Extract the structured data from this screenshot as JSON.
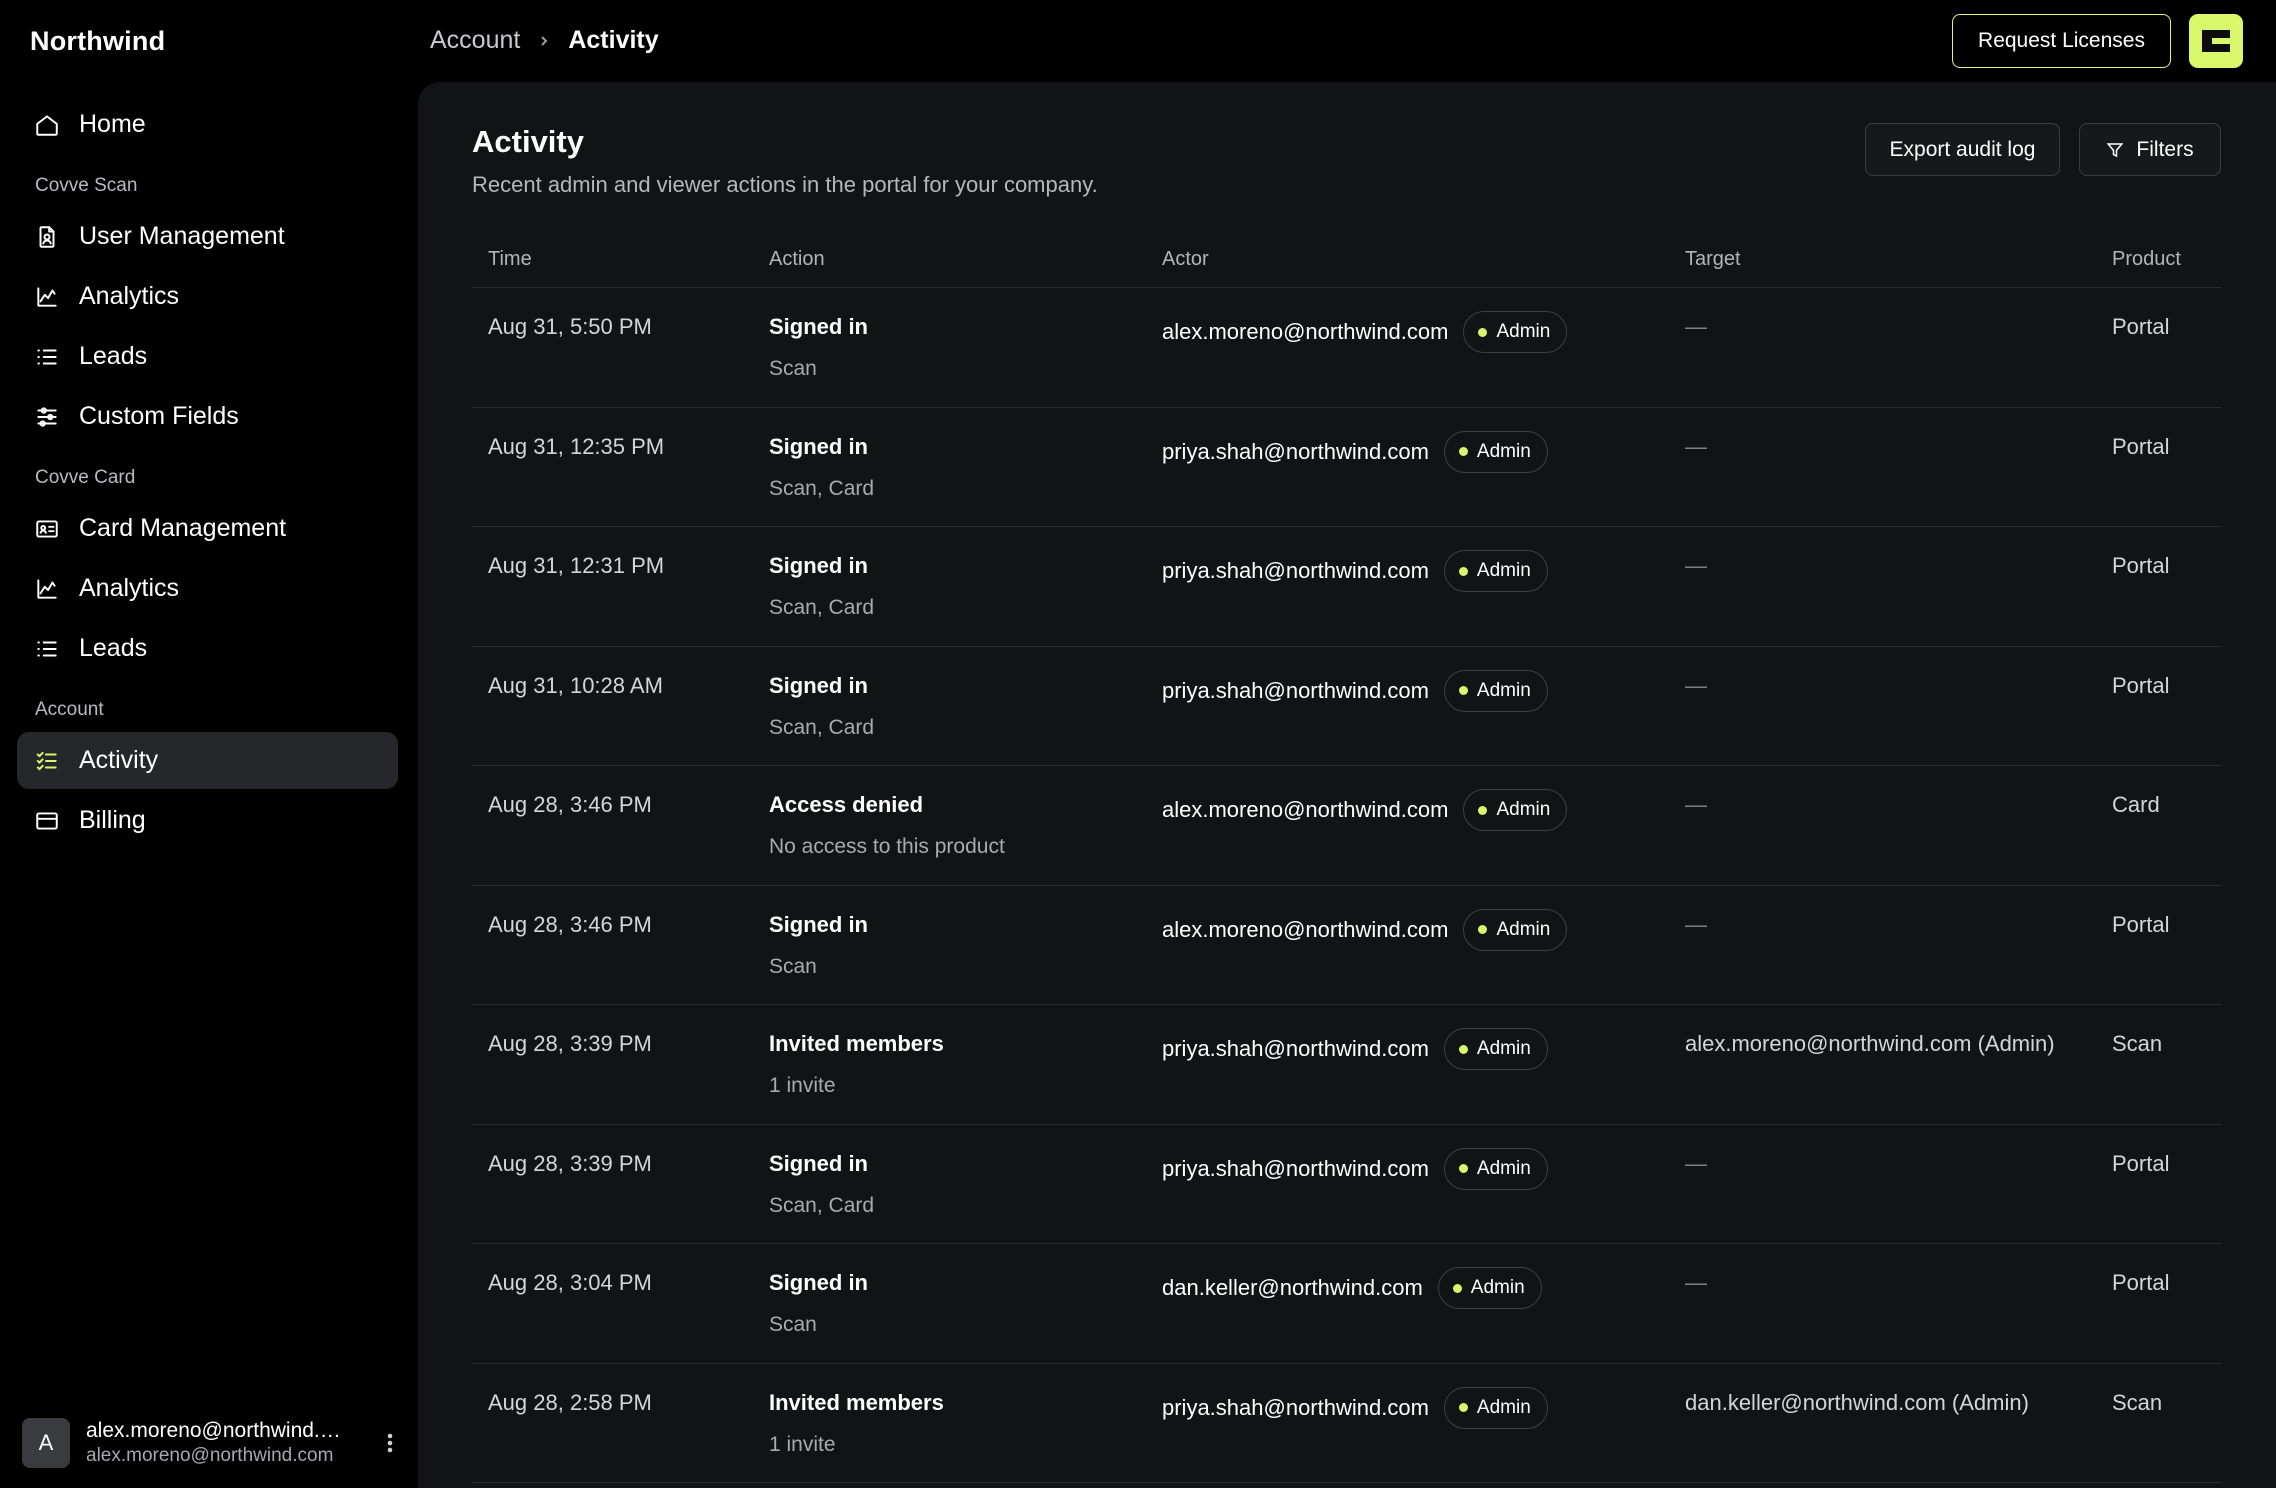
{
  "app": {
    "name": "Northwind"
  },
  "sidebar": {
    "top_items": [
      {
        "label": "Home",
        "icon": "home-icon"
      }
    ],
    "sections": [
      {
        "title": "Covve Scan",
        "items": [
          {
            "label": "User Management",
            "icon": "user-badge-icon"
          },
          {
            "label": "Analytics",
            "icon": "chart-icon"
          },
          {
            "label": "Leads",
            "icon": "list-icon"
          },
          {
            "label": "Custom Fields",
            "icon": "sliders-icon"
          }
        ]
      },
      {
        "title": "Covve Card",
        "items": [
          {
            "label": "Card Management",
            "icon": "id-card-icon"
          },
          {
            "label": "Analytics",
            "icon": "chart-icon"
          },
          {
            "label": "Leads",
            "icon": "list-icon"
          }
        ]
      },
      {
        "title": "Account",
        "items": [
          {
            "label": "Activity",
            "icon": "checklist-icon",
            "active": true
          },
          {
            "label": "Billing",
            "icon": "credit-card-icon"
          }
        ]
      }
    ],
    "user": {
      "initial": "A",
      "name": "alex.moreno@northwind.…",
      "email": "alex.moreno@northwind.com"
    }
  },
  "topbar": {
    "breadcrumb": {
      "parent": "Account",
      "current": "Activity"
    },
    "request_label": "Request Licenses",
    "accent": "#d8f76b"
  },
  "page": {
    "title": "Activity",
    "subtitle": "Recent admin and viewer actions in the portal for your company.",
    "export_label": "Export audit log",
    "filters_label": "Filters"
  },
  "table": {
    "columns": [
      "Time",
      "Action",
      "Actor",
      "Target",
      "Product"
    ],
    "rows": [
      {
        "time": "Aug 31, 5:50 PM",
        "action": "Signed in",
        "detail": "Scan",
        "actor": "alex.moreno@northwind.com",
        "role": "Admin",
        "target": "—",
        "product": "Portal"
      },
      {
        "time": "Aug 31, 12:35 PM",
        "action": "Signed in",
        "detail": "Scan, Card",
        "actor": "priya.shah@northwind.com",
        "role": "Admin",
        "target": "—",
        "product": "Portal"
      },
      {
        "time": "Aug 31, 12:31 PM",
        "action": "Signed in",
        "detail": "Scan, Card",
        "actor": "priya.shah@northwind.com",
        "role": "Admin",
        "target": "—",
        "product": "Portal"
      },
      {
        "time": "Aug 31, 10:28 AM",
        "action": "Signed in",
        "detail": "Scan, Card",
        "actor": "priya.shah@northwind.com",
        "role": "Admin",
        "target": "—",
        "product": "Portal"
      },
      {
        "time": "Aug 28, 3:46 PM",
        "action": "Access denied",
        "detail": "No access to this product",
        "actor": "alex.moreno@northwind.com",
        "role": "Admin",
        "target": "—",
        "product": "Card"
      },
      {
        "time": "Aug 28, 3:46 PM",
        "action": "Signed in",
        "detail": "Scan",
        "actor": "alex.moreno@northwind.com",
        "role": "Admin",
        "target": "—",
        "product": "Portal"
      },
      {
        "time": "Aug 28, 3:39 PM",
        "action": "Invited members",
        "detail": "1 invite",
        "actor": "priya.shah@northwind.com",
        "role": "Admin",
        "target": "alex.moreno@northwind.com (Admin)",
        "product": "Scan"
      },
      {
        "time": "Aug 28, 3:39 PM",
        "action": "Signed in",
        "detail": "Scan, Card",
        "actor": "priya.shah@northwind.com",
        "role": "Admin",
        "target": "—",
        "product": "Portal"
      },
      {
        "time": "Aug 28, 3:04 PM",
        "action": "Signed in",
        "detail": "Scan",
        "actor": "dan.keller@northwind.com",
        "role": "Admin",
        "target": "—",
        "product": "Portal"
      },
      {
        "time": "Aug 28, 2:58 PM",
        "action": "Invited members",
        "detail": "1 invite",
        "actor": "priya.shah@northwind.com",
        "role": "Admin",
        "target": "dan.keller@northwind.com (Admin)",
        "product": "Scan"
      }
    ]
  }
}
